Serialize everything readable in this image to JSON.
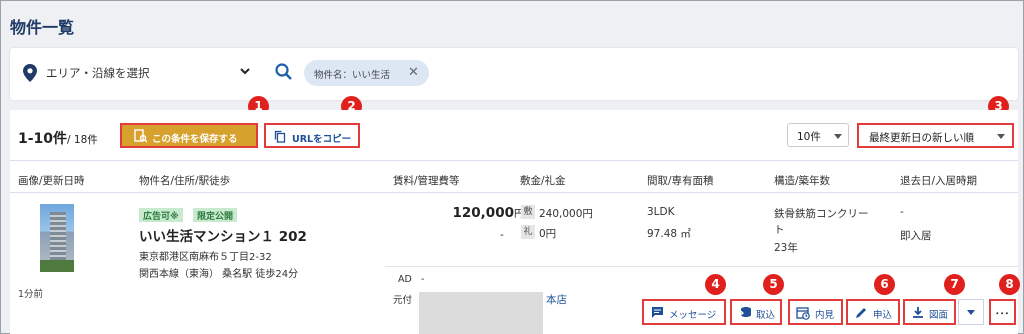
{
  "page": {
    "title": "物件一覧"
  },
  "search": {
    "area_label": "エリア・沿線を選択",
    "chip_label": "物件名：いい生活"
  },
  "toolbar": {
    "count_label": "1-10件",
    "count_total": "/ 18件",
    "save_label": "この条件を保存する",
    "copy_url_label": "URLをコピー",
    "per_page": "10件",
    "sort": "最終更新日の新しい順"
  },
  "callouts": [
    "1",
    "2",
    "3",
    "4",
    "5",
    "6",
    "7",
    "8"
  ],
  "table": {
    "headers": [
      "画像/更新日時",
      "物件名/住所/駅徒歩",
      "賃料/管理費等",
      "敷金/礼金",
      "間取/専有面積",
      "構造/築年数",
      "退去日/入居時期"
    ]
  },
  "row": {
    "updated": "1分前",
    "tags": [
      "広告可※",
      "限定公開"
    ],
    "name": "いい生活マンション１ 202",
    "address": "東京都港区南麻布５丁目2-32",
    "station": "関西本線（東海） 桑名駅 徒歩24分",
    "rent": "120,000",
    "rent_unit": "円",
    "mgmt_fee": "-",
    "deposit_mark": "敷",
    "deposit": "240,000円",
    "key_money_mark": "礼",
    "key_money": "0円",
    "layout": "3LDK",
    "area": "97.48 ㎡",
    "structure_1": "鉄骨鉄筋コンクリー",
    "structure_2": "ト",
    "age": "23年",
    "move_out": "-",
    "move_in": "即入居",
    "ad_label": "AD",
    "ad_value": "-",
    "source_label": "元付",
    "branch": "本店"
  },
  "actions": {
    "message": "メッセージ",
    "import": "取込",
    "viewing": "内見",
    "apply": "申込",
    "floorplan": "図面",
    "more": "･･･"
  },
  "colors": {
    "accent": "#1f4f99",
    "save_button": "#d7a12e",
    "callout": "#e0201c",
    "tag_bg": "#c8ebd0"
  }
}
